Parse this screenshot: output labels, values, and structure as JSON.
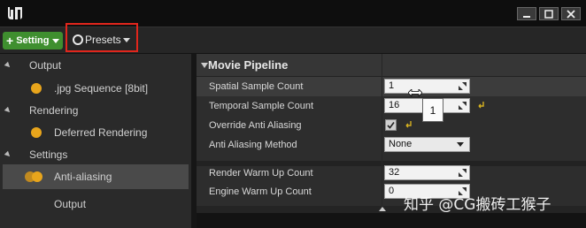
{
  "toolbar": {
    "setting_label": "Setting",
    "presets_label": "Presets"
  },
  "left_panel": {
    "rows": [
      {
        "kind": "category",
        "label": "Output"
      },
      {
        "kind": "item",
        "label": ".jpg Sequence [8bit]"
      },
      {
        "kind": "category",
        "label": "Rendering"
      },
      {
        "kind": "item",
        "label": "Deferred Rendering"
      },
      {
        "kind": "category",
        "label": "Settings"
      },
      {
        "kind": "item",
        "label": "Anti-aliasing",
        "selected": true
      },
      {
        "kind": "item",
        "label": "Output"
      }
    ]
  },
  "details": {
    "section_title": "Movie Pipeline",
    "properties": [
      {
        "label": "Spatial Sample Count",
        "value": "1"
      },
      {
        "label": "Temporal Sample Count",
        "value": "16"
      },
      {
        "label": "Override Anti Aliasing",
        "checked": true
      },
      {
        "label": "Anti Aliasing Method",
        "value": "None"
      },
      {
        "label": "Render Warm Up Count",
        "value": "32"
      },
      {
        "label": "Engine Warm Up Count",
        "value": "0"
      }
    ],
    "tooltip": "1"
  },
  "watermark": "知乎 @CG搬砖工猴子",
  "colors": {
    "accent_green": "#3f8f2f",
    "highlight_red": "#e1261c",
    "toggle_orange": "#e8a51c"
  }
}
